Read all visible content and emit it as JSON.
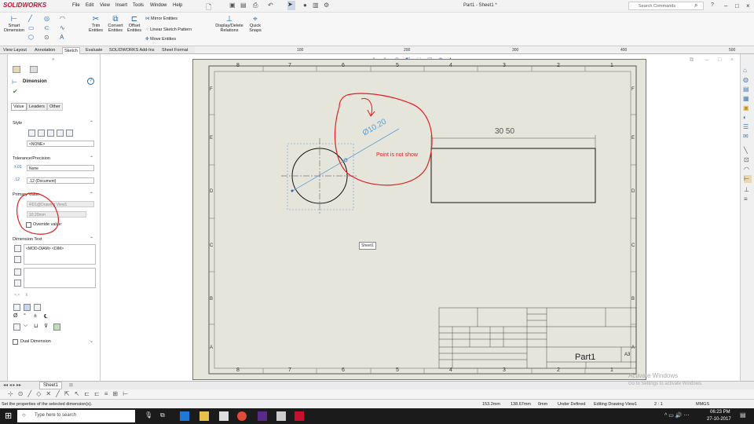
{
  "app": {
    "logo": "SOLIDWORKS",
    "menu": [
      "File",
      "Edit",
      "View",
      "Insert",
      "Tools",
      "Window",
      "Help"
    ],
    "doc_title": "Part1 - Sheet1 *",
    "search_placeholder": "Search Commands"
  },
  "command_manager": {
    "smart_dimension": "Smart\nDimension",
    "trim": "Trim\nEntities",
    "convert": "Convert\nEntities",
    "offset": "Offset\nEntities",
    "mirror": "Mirror Entities",
    "linear_pattern": "Linear Sketch Pattern",
    "move": "Move Entities",
    "display_delete": "Display/Delete\nRelations",
    "quick_snaps": "Quick\nSnaps"
  },
  "tabs": [
    "View Layout",
    "Annotation",
    "Sketch",
    "Evaluate",
    "SOLIDWORKS Add-Ins",
    "Sheet Format"
  ],
  "active_tab": "Sketch",
  "ruler_labels": [
    "100",
    "200",
    "300",
    "400",
    "500"
  ],
  "property_manager": {
    "title": "Dimension",
    "subtabs": [
      "Value",
      "Leaders",
      "Other"
    ],
    "style_header": "Style",
    "style_value": "<NONE>",
    "tolerance_header": "Tolerance/Precision",
    "tolerance_value": "None",
    "precision_value": ".12 (Document)",
    "primary_value_header": "Primary Value",
    "primary_ref": "RD1@Drawing View1",
    "primary_value": "10.20mm",
    "override_label": "Override value:",
    "dimension_text_header": "Dimension Text",
    "dimension_text": "<MOD-DIAM> <DIM>",
    "dual_dimension_label": "Dual Dimension"
  },
  "drawing": {
    "col_labels_top": [
      "8",
      "7",
      "6",
      "5",
      "4",
      "3",
      "2",
      "1"
    ],
    "row_labels": [
      "F",
      "E",
      "D",
      "C",
      "B",
      "A"
    ],
    "diameter_label": "Ø10.20",
    "rect_dim": "30 50",
    "annotation": "Point is not show",
    "sheet_tooltip": "Sheet1",
    "part_name": "Part1",
    "sheet_size": "A3"
  },
  "bottom": {
    "sheet_tab": "Sheet1"
  },
  "status": {
    "hint": "Set the properties of the selected dimension(s).",
    "x": "153.2mm",
    "y": "138.67mm",
    "z": "0mm",
    "defined": "Under Defined",
    "editing": "Editing Drawing View1",
    "scale": "2 : 1",
    "units": "MMGS"
  },
  "watermark": {
    "line1": "Activate Windows",
    "line2": "Go to Settings to activate Windows."
  },
  "taskbar": {
    "search": "Type here to search",
    "time": "06:23 PM",
    "date": "27-10-2017"
  },
  "colors": {
    "annotation_red": "#e02020",
    "dimension_blue": "#5b9bd5",
    "sheet_bg": "#e6e5dc"
  }
}
